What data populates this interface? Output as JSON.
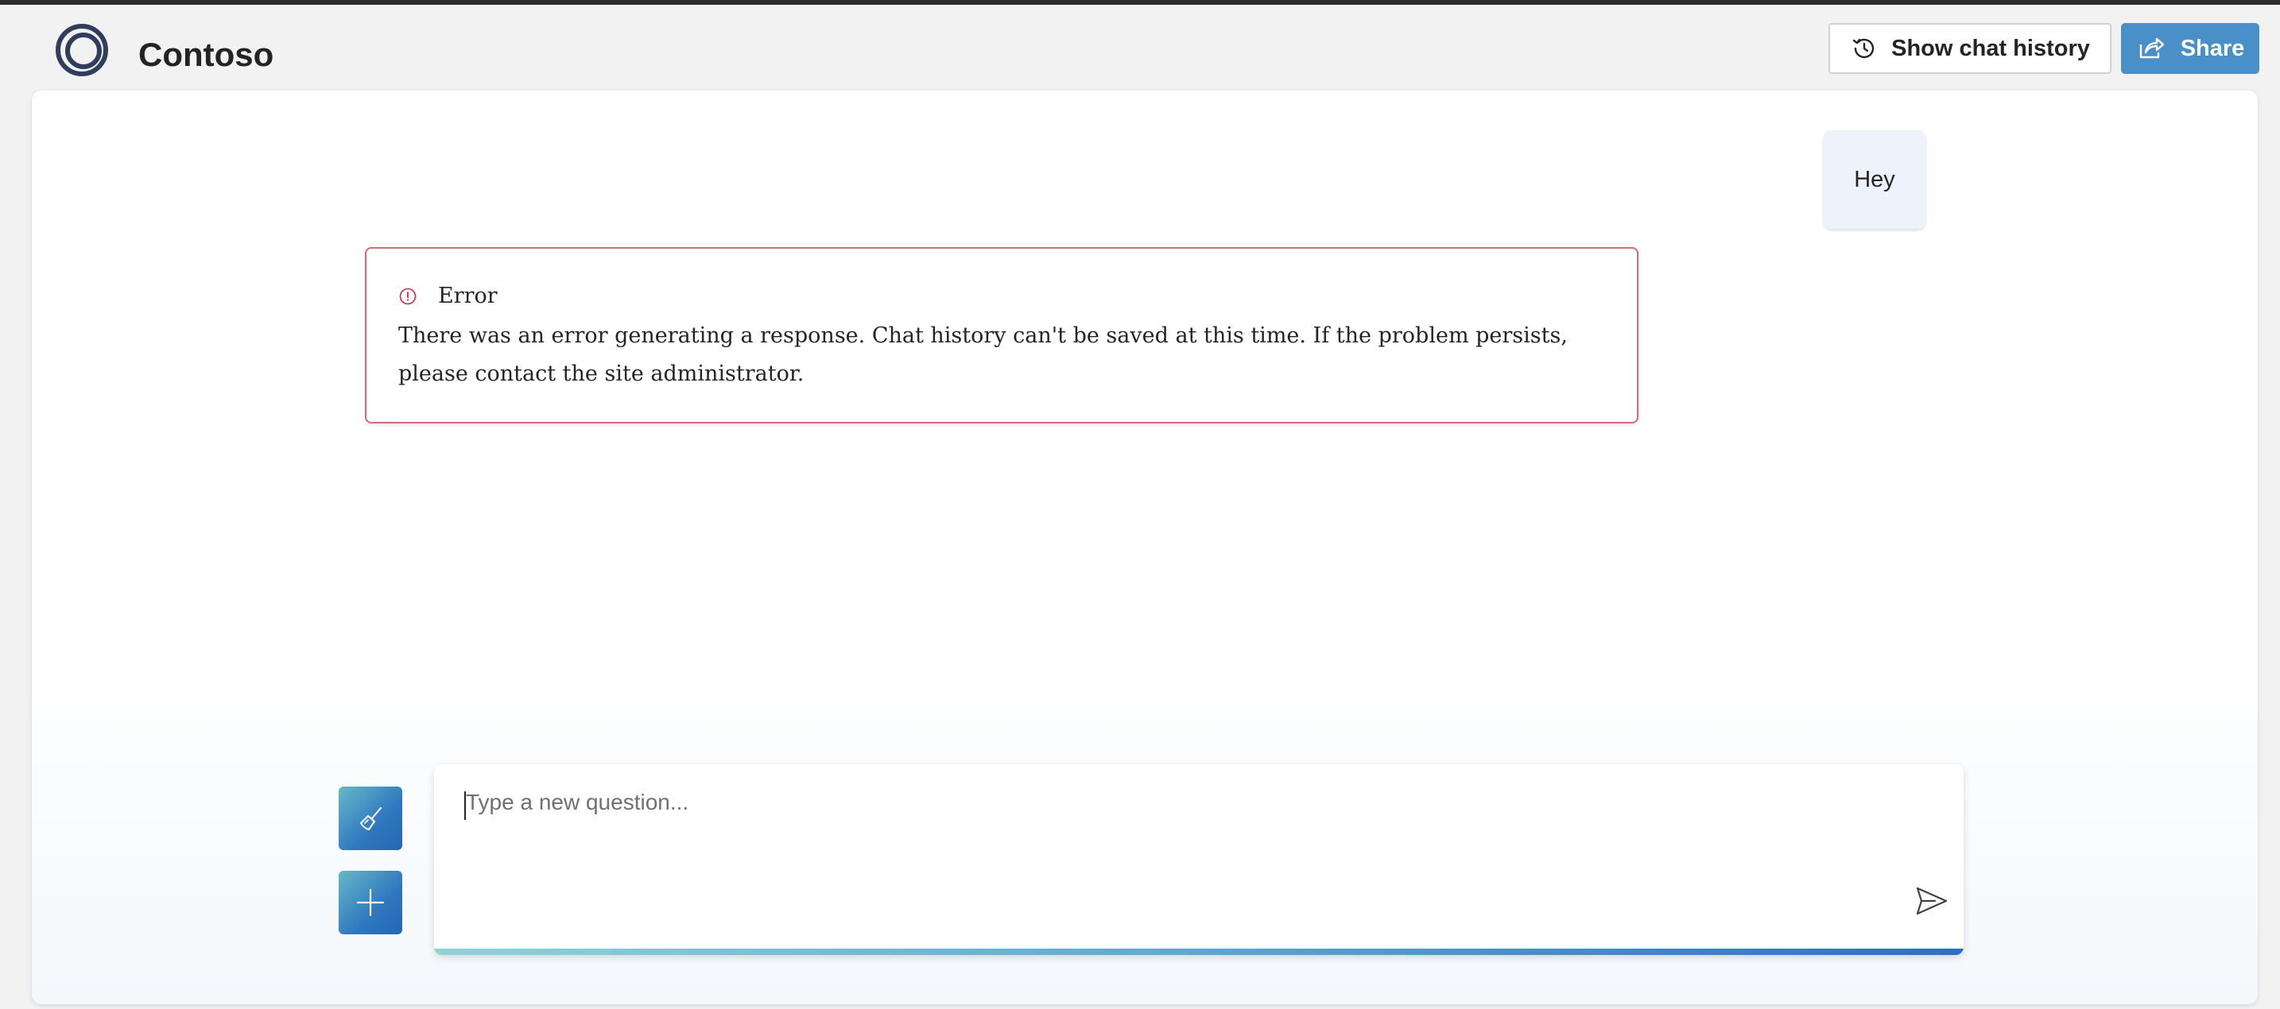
{
  "app": {
    "brand": "Contoso"
  },
  "header": {
    "history_button_label": "Show chat history",
    "share_button_label": "Share"
  },
  "chat": {
    "user_message": "Hey",
    "error": {
      "title": "Error",
      "message": "There was an error generating a response. Chat history can't be saved at this time. If the problem persists, please contact the site administrator."
    }
  },
  "composer": {
    "placeholder": "Type a new question...",
    "value": ""
  },
  "icons": {
    "logo": "contoso-ring-logo",
    "history": "history-clock-icon",
    "share": "share-arrow-icon",
    "error": "error-circle-icon",
    "clear": "broom-icon",
    "new_chat": "plus-icon",
    "send": "send-icon"
  },
  "colors": {
    "share_button": "#4a90c8",
    "error_border": "#d66a78",
    "error_icon": "#c4314b",
    "accent_gradient_start": "#8fd3d7",
    "accent_gradient_end": "#2d6fc0",
    "user_bubble": "#edf3fb"
  }
}
